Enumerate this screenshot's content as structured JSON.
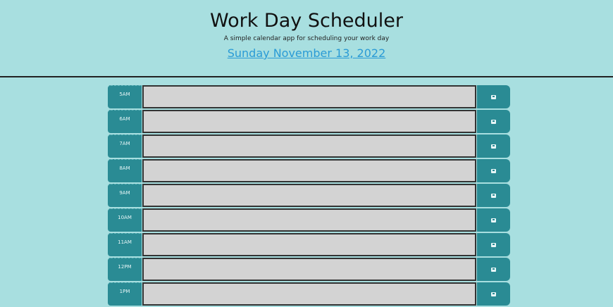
{
  "header": {
    "title": "Work Day Scheduler",
    "lead": "A simple calendar app for scheduling your work day",
    "current_day": "Sunday November 13, 2022"
  },
  "rows": [
    {
      "hour": "5AM",
      "text": ""
    },
    {
      "hour": "6AM",
      "text": ""
    },
    {
      "hour": "7AM",
      "text": ""
    },
    {
      "hour": "8AM",
      "text": ""
    },
    {
      "hour": "9AM",
      "text": ""
    },
    {
      "hour": "10AM",
      "text": ""
    },
    {
      "hour": "11AM",
      "text": ""
    },
    {
      "hour": "12PM",
      "text": ""
    },
    {
      "hour": "1PM",
      "text": ""
    }
  ],
  "icons": {
    "save": "save-icon"
  },
  "colors": {
    "background": "#a8dfe0",
    "hour_block": "#2a8b94",
    "textarea": "#d3d3d3",
    "date_link": "#2a9bd6"
  }
}
